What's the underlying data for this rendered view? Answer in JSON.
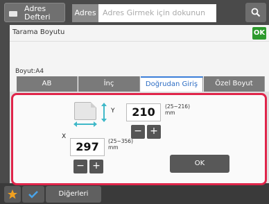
{
  "topbar": {
    "address_book_label": "Adres Defteri",
    "address_tab": "Adres",
    "address_placeholder": "Adres Girmek için dokunun",
    "search_icon": "search-icon"
  },
  "dialog": {
    "title": "Tarama Boyutu",
    "ok_label": "OK",
    "size_label": "Boyut:A4",
    "tabs": [
      {
        "label": "AB"
      },
      {
        "label": "İnç"
      },
      {
        "label": "Doğrudan Giriş",
        "active": true
      },
      {
        "label": "Özel Boyut"
      }
    ]
  },
  "popup": {
    "y_label": "Y",
    "y_value": "210",
    "y_range": "(25~216)",
    "y_unit": "mm",
    "x_label": "X",
    "x_value": "297",
    "x_range": "(25~356)",
    "x_unit": "mm",
    "minus": "−",
    "plus": "+",
    "ok_label": "OK"
  },
  "bottombar": {
    "others_label": "Diğerleri"
  },
  "colors": {
    "highlight_border": "#e0254a",
    "ok_green": "#2d9a2d",
    "active_tab_text": "#2b6cc4",
    "arrow_teal": "#3fb8c8"
  }
}
